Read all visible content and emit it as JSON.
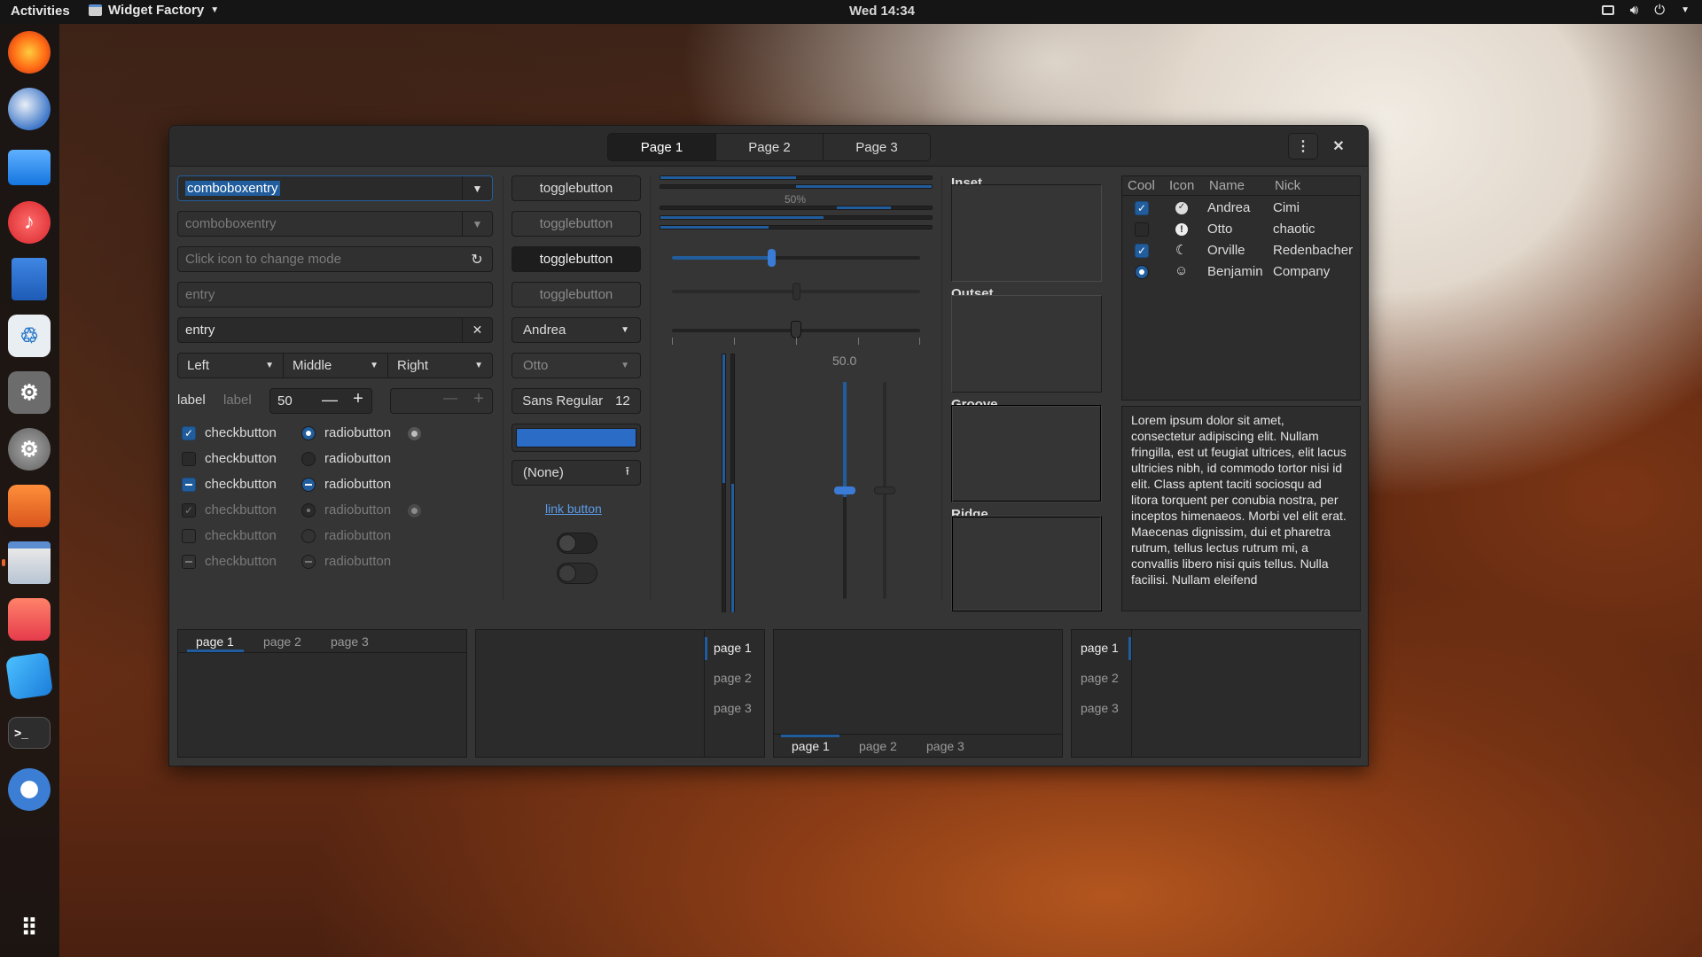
{
  "topbar": {
    "activities": "Activities",
    "app_name": "Widget Factory",
    "clock": "Wed 14:34"
  },
  "window": {
    "tabs": [
      "Page 1",
      "Page 2",
      "Page 3"
    ],
    "col1": {
      "combo1": "comboboxentry",
      "combo2": "comboboxentry",
      "entry_icon_placeholder": "Click icon to change mode",
      "entry_placeholder": "entry",
      "entry_value": "entry",
      "combo_left": "Left",
      "combo_middle": "Middle",
      "combo_right": "Right",
      "label1": "label",
      "label2": "label",
      "spin_value": "50",
      "checks": [
        "checkbutton",
        "checkbutton",
        "checkbutton",
        "checkbutton",
        "checkbutton",
        "checkbutton"
      ],
      "radios": [
        "radiobutton",
        "radiobutton",
        "radiobutton",
        "radiobutton",
        "radiobutton",
        "radiobutton"
      ]
    },
    "col2": {
      "toggles": [
        "togglebutton",
        "togglebutton",
        "togglebutton",
        "togglebutton"
      ],
      "combo_andrea": "Andrea",
      "combo_otto": "Otto",
      "font_name": "Sans Regular",
      "font_size": "12",
      "file_none": "(None)",
      "link": "link button",
      "color_accent": "#2b6cc7"
    },
    "col3": {
      "progress_label": "50%",
      "scale_value": "50.0",
      "progress": 0.5
    },
    "frames": [
      "Inset",
      "Outset",
      "Groove",
      "Ridge"
    ],
    "tree": {
      "headers": [
        "Cool",
        "Icon",
        "Name",
        "Nick"
      ],
      "rows": [
        {
          "name": "Andrea",
          "nick": "Cimi",
          "icon": "check-circle-icon"
        },
        {
          "name": "Otto",
          "nick": "chaotic",
          "icon": "alert-icon"
        },
        {
          "name": "Orville",
          "nick": "Redenbacher",
          "icon": "moon-icon"
        },
        {
          "name": "Benjamin",
          "nick": "Company",
          "icon": "face-icon"
        }
      ]
    },
    "text": "Lorem ipsum dolor sit amet, consectetur adipiscing elit. Nullam fringilla, est ut feugiat ultrices, elit lacus ultricies nibh, id commodo tortor nisi id elit. Class aptent taciti sociosqu ad litora torquent per conubia nostra, per inceptos himenaeos. Morbi vel elit erat. Maecenas dignissim, dui et pharetra rutrum, tellus lectus rutrum mi, a convallis libero nisi quis tellus. Nulla facilisi. Nullam eleifend",
    "notebooks": {
      "pages": [
        "page 1",
        "page 2",
        "page 3"
      ]
    }
  },
  "colors": {
    "accent": "#215d9c",
    "bg": "#353535",
    "panel": "#151515"
  }
}
